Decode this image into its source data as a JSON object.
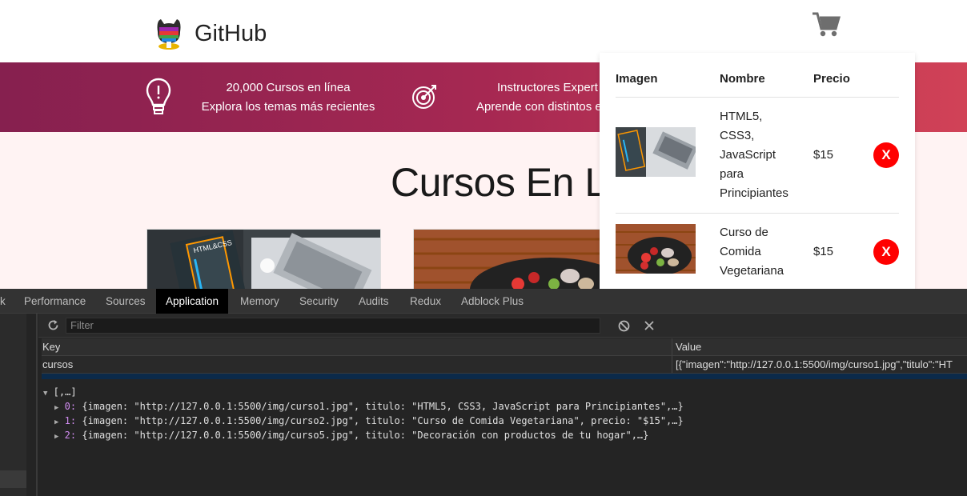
{
  "header": {
    "brand": "GitHub",
    "logo_icon": "octocat-logo",
    "cart_icon": "shopping-cart-icon"
  },
  "banner": {
    "items": [
      {
        "icon": "lightbulb-icon",
        "line1": "20,000 Cursos en línea",
        "line2": "Explora los temas más recientes"
      },
      {
        "icon": "target-icon",
        "line1": "Instructores Expert",
        "line2": "Aprende con distintos e"
      }
    ]
  },
  "main": {
    "title": "Cursos En L"
  },
  "cart": {
    "headers": {
      "image": "Imagen",
      "name": "Nombre",
      "price": "Precio"
    },
    "items": [
      {
        "name_lines": [
          "HTML5,",
          "CSS3,",
          "JavaScript",
          "para",
          "Principiantes"
        ],
        "price": "$15",
        "remove": "X"
      },
      {
        "name_lines": [
          "Curso de",
          "Comida",
          "Vegetariana"
        ],
        "price": "$15",
        "remove": "X"
      }
    ]
  },
  "devtools": {
    "tabs": [
      "k",
      "Performance",
      "Sources",
      "Application",
      "Memory",
      "Security",
      "Audits",
      "Redux",
      "Adblock Plus"
    ],
    "active_tab": "Application",
    "filter_placeholder": "Filter",
    "grid": {
      "key_header": "Key",
      "value_header": "Value",
      "rows": [
        {
          "key": "cursos",
          "value": "[{\"imagen\":\"http://127.0.0.1:5500/img/curso1.jpg\",\"titulo\":\"HT"
        }
      ]
    },
    "preview": {
      "root": "[,…]",
      "entries": [
        {
          "index": "0",
          "text": "{imagen: \"http://127.0.0.1:5500/img/curso1.jpg\", titulo: \"HTML5, CSS3, JavaScript para Principiantes\",…}"
        },
        {
          "index": "1",
          "text": "{imagen: \"http://127.0.0.1:5500/img/curso2.jpg\", titulo: \"Curso de Comida Vegetariana\", precio: \"$15\",…}"
        },
        {
          "index": "2",
          "text": "{imagen: \"http://127.0.0.1:5500/img/curso5.jpg\", titulo: \"Decoración con productos de tu hogar\",…}"
        }
      ]
    }
  }
}
